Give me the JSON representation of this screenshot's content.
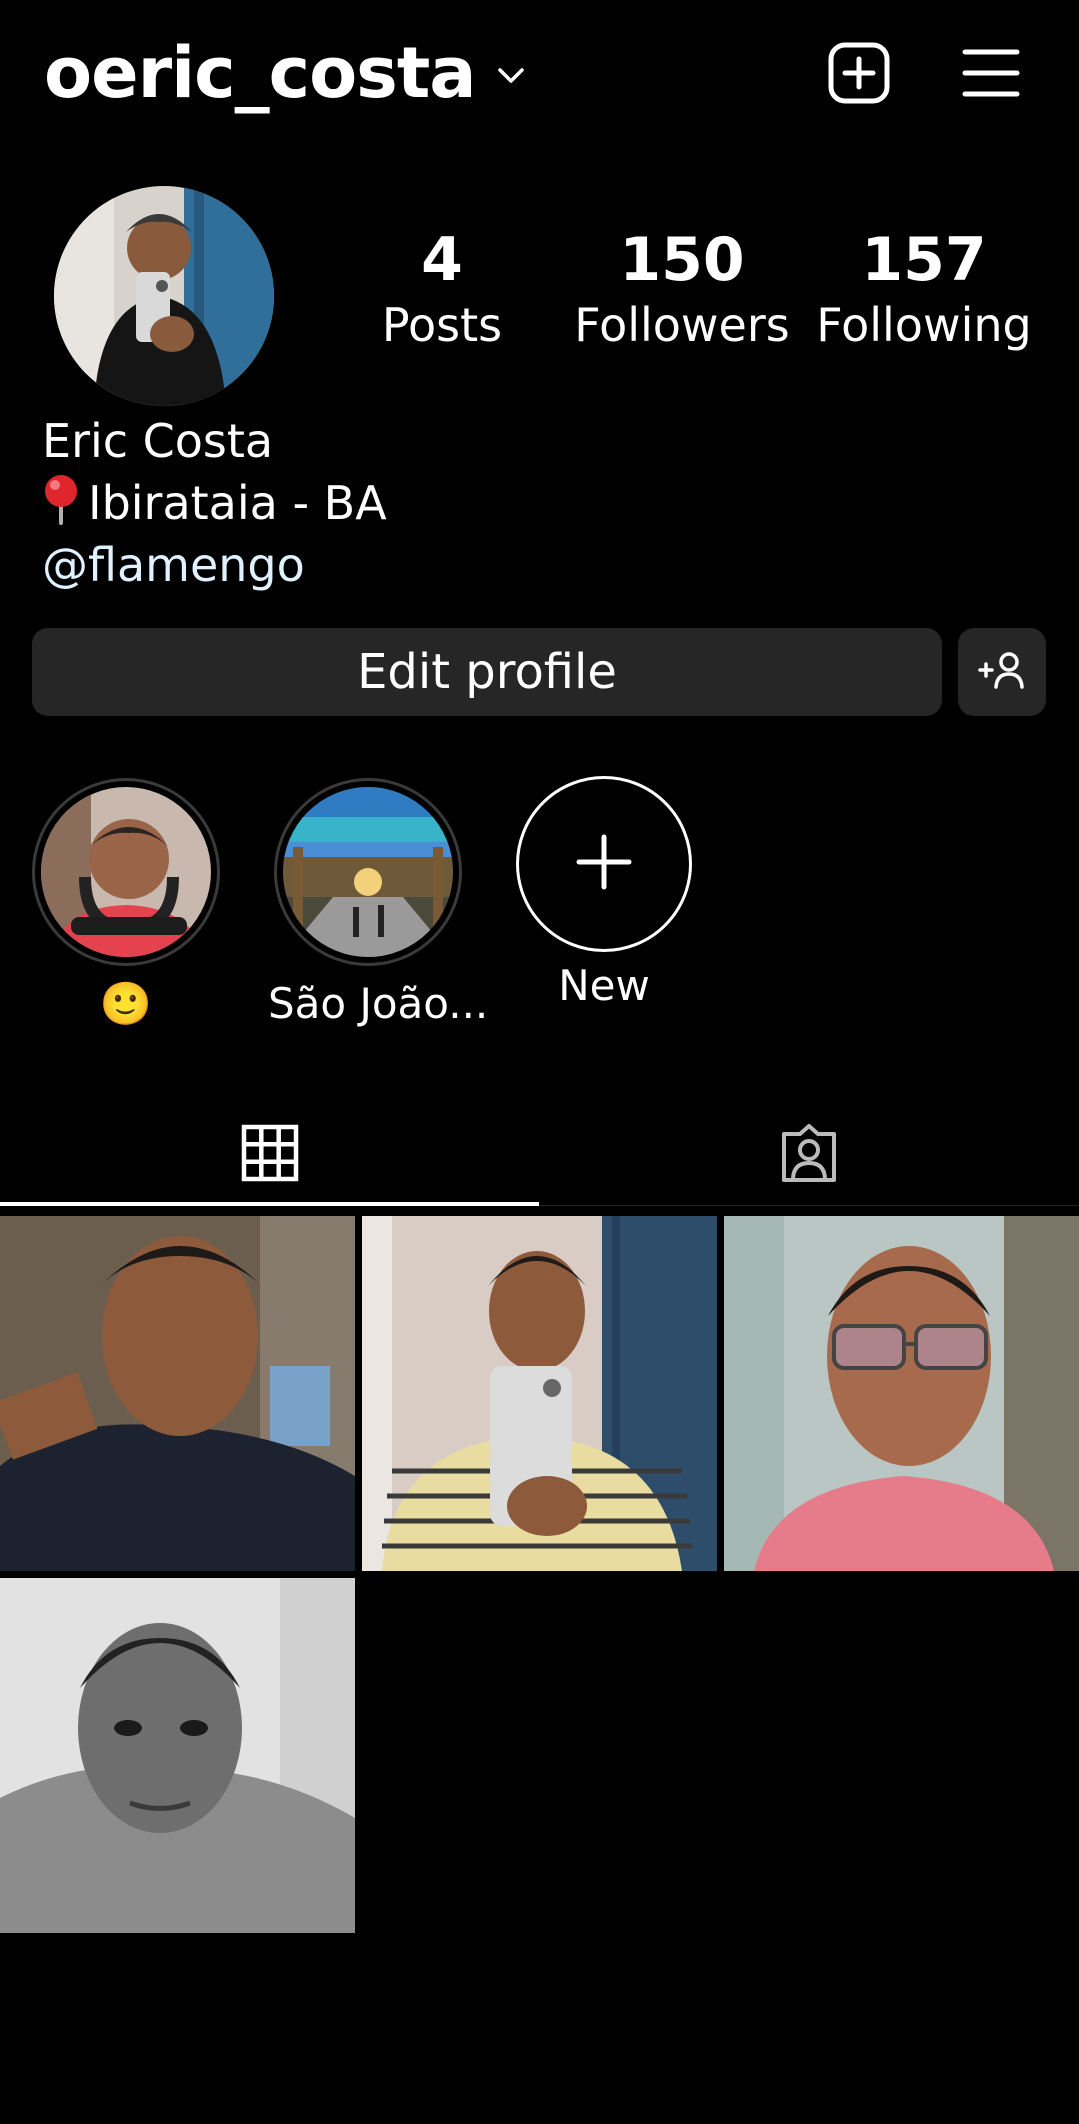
{
  "header": {
    "username": "oeric_costa",
    "icons": {
      "account_switcher": "chevron-down-icon",
      "create": "plus-square-icon",
      "menu": "hamburger-menu-icon"
    }
  },
  "profile": {
    "stats": [
      {
        "value": "4",
        "label": "Posts"
      },
      {
        "value": "150",
        "label": "Followers"
      },
      {
        "value": "157",
        "label": "Following"
      }
    ],
    "name": "Eric Costa",
    "location": "Ibirataia - BA",
    "location_icon": "round-pushpin-icon",
    "handle": "@flamengo"
  },
  "actions": {
    "edit_profile": "Edit profile",
    "discover_people_icon": "person-add-icon"
  },
  "highlights": [
    {
      "label": "🙂"
    },
    {
      "label": "São João..."
    },
    {
      "label": "New",
      "icon": "plus-icon"
    }
  ],
  "tabs": [
    {
      "icon": "grid-icon",
      "active": true
    },
    {
      "icon": "tagged-person-icon",
      "active": false
    }
  ],
  "colors": {
    "background": "#000000",
    "button_bg": "#262626",
    "handle_text": "#e0f1ff"
  }
}
